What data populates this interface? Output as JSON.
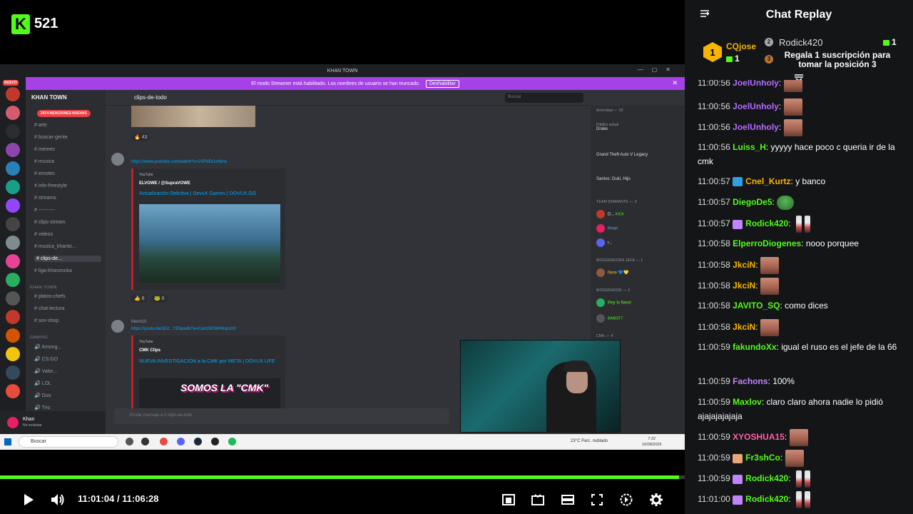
{
  "player": {
    "viewers": "521",
    "logo_letter": "K",
    "current_time": "11:01:04",
    "separator": " / ",
    "total_time": "11:06:28",
    "progress": 0.992
  },
  "stream_screen": {
    "window_title": "KHAN TOWN",
    "banner_text": "El modo Streamer está habilitado. Los nombres de usuario se han truncado.",
    "banner_button": "Deshabilitar",
    "server_name": "KHAN TOWN",
    "nuevo": "NUEVO",
    "mentions": "2474 MENCIONES NUEVAS",
    "channels": [
      "arte",
      "buscar-gente",
      "memes",
      "musica",
      "emotes",
      "info-freestyle",
      "streams",
      "----------",
      "clips-stream",
      "videos",
      "musica_khanto...",
      "clips-de...",
      "liga-khanzooka"
    ],
    "category_khan": "KHAN TOWN",
    "channels2": [
      "platos-chefs",
      "chat-lectura",
      "sex-shop"
    ],
    "category_gaming": "GAMING",
    "voice_channels": [
      "Among...",
      "CS:GO",
      "Valor...",
      "LOL",
      "Duo",
      "Trio"
    ],
    "user_name": "Khan",
    "user_status": "No molestar",
    "current_channel": "clips-de-todo",
    "search_placeholder": "Buscar",
    "reaction1": "43",
    "link1": "https://www.youtube.com/watch?v=2SPdDr1eNmo",
    "embed1_src": "YouTube",
    "embed1_author": "ELVOWE / @SupraVOWE",
    "embed1_title": "Actualización Delictiva | DevuX Games | DOVUX.GG",
    "reaction2a": "8",
    "reaction2b": "8",
    "author2": "Mech10",
    "link2": "https://youtu.be/1E2...YEbpadk?si=CahzWSMHKqcch0",
    "embed2_src": "YouTube",
    "embed2_author": "CMK Clips",
    "embed2_title": "NUEVA INVESTIGACIÓN a la CMK por META | DOVUX LIFE",
    "thumb_text": "SOMOS LA \"CMK\"",
    "input_placeholder": "Enviar mensaje a # clips-de-todo",
    "members": {
      "activity": "Actividad — 20",
      "m1_name": "Drake",
      "m1_status": "Público actual",
      "m2_game": "Grand Theft Auto V Legacy",
      "m3_game": "Santos: Duki, Hijo",
      "cat_diamante": "TEAM DIAMANTE — 3",
      "d1": "D...",
      "d1_tag": "KICK",
      "d2": "Khan",
      "d3": "r...",
      "cat_jefa": "MODERADORA JEFA — 1",
      "j1": "Nere",
      "cat_mod": "MODERADOR — 2",
      "mod1": "Rey lo flavol",
      "mod2": "BANDITT",
      "cat_cmk": "CMK — 4"
    },
    "taskbar_search": "Buscar",
    "weather": "23°C  Parc. nublado",
    "clock_time": "7:22",
    "clock_date": "16/08/2025"
  },
  "chat": {
    "title": "Chat Replay",
    "pinned": {
      "rank1": "1",
      "rank1_name": "CQjose",
      "rank1_count": "1",
      "rank2_name": "Rodick420",
      "rank2_count": "1",
      "rank2_num": "2",
      "rank3_num": "3",
      "rank3_text": "Regala 1 suscripción para tomar la posición 3"
    },
    "messages": [
      {
        "time": "11:00:56",
        "user": "JoelUnholy",
        "color": "#b36bff",
        "text": "",
        "emote": "face"
      },
      {
        "time": "11:00:56",
        "user": "JoelUnholy",
        "color": "#b36bff",
        "text": "",
        "emote": "face"
      },
      {
        "time": "11:00:56",
        "user": "JoelUnholy",
        "color": "#b36bff",
        "text": "",
        "emote": "face"
      },
      {
        "time": "11:00:56",
        "user": "Luiss_H",
        "color": "#53fc18",
        "text": " yyyyy hace poco c queria ir de la cmk",
        "emote": ""
      },
      {
        "time": "11:00:57",
        "user": "Cnel_Kurtz",
        "color": "#f7b500",
        "text": " y banco",
        "emote": "",
        "badge": "#2ea0e6"
      },
      {
        "time": "11:00:57",
        "user": "DiegoDe5",
        "color": "#53fc18",
        "text": "",
        "emote": "pepe"
      },
      {
        "time": "11:00:57",
        "user": "Rodick420",
        "color": "#53fc18",
        "text": "",
        "emote": "small2",
        "badge": "#c084fc"
      },
      {
        "time": "11:00:58",
        "user": "ElperroDiogenes",
        "color": "#53fc18",
        "text": " nooo porquee",
        "emote": ""
      },
      {
        "time": "11:00:58",
        "user": "JkciN",
        "color": "#f7b500",
        "text": "",
        "emote": "face"
      },
      {
        "time": "11:00:58",
        "user": "JkciN",
        "color": "#f7b500",
        "text": "",
        "emote": "face"
      },
      {
        "time": "11:00:58",
        "user": "JAVITO_SQ",
        "color": "#53fc18",
        "text": " como dices",
        "emote": ""
      },
      {
        "time": "11:00:58",
        "user": "JkciN",
        "color": "#f7b500",
        "text": "",
        "emote": "face"
      },
      {
        "time": "11:00:59",
        "user": "fakundoXx",
        "color": "#53fc18",
        "text": " igual el ruso es el jefe de la 66",
        "emote": ""
      },
      {
        "time": "11:00:59",
        "user": "Fachons",
        "color": "#c084fc",
        "text": " 100%",
        "emote": ""
      },
      {
        "time": "11:00:59",
        "user": "Maxlov",
        "color": "#53fc18",
        "text": " claro claro ahora nadie lo pidió ajajajajajaja",
        "emote": ""
      },
      {
        "time": "11:00:59",
        "user": "XYOSHUA15",
        "color": "#ff5ea8",
        "text": "",
        "emote": "face"
      },
      {
        "time": "11:00:59",
        "user": "Fr3shCo",
        "color": "#53fc18",
        "text": "",
        "emote": "face",
        "badge": "#e8a77a"
      },
      {
        "time": "11:00:59",
        "user": "Rodick420",
        "color": "#53fc18",
        "text": "",
        "emote": "small2",
        "badge": "#c084fc"
      },
      {
        "time": "11:01:00",
        "user": "Rodick420",
        "color": "#53fc18",
        "text": "",
        "emote": "small2",
        "badge": "#c084fc"
      }
    ]
  },
  "colors": {
    "kick_green": "#53fc18",
    "chat_bg": "#141517",
    "banner_purple": "#a641e8"
  }
}
